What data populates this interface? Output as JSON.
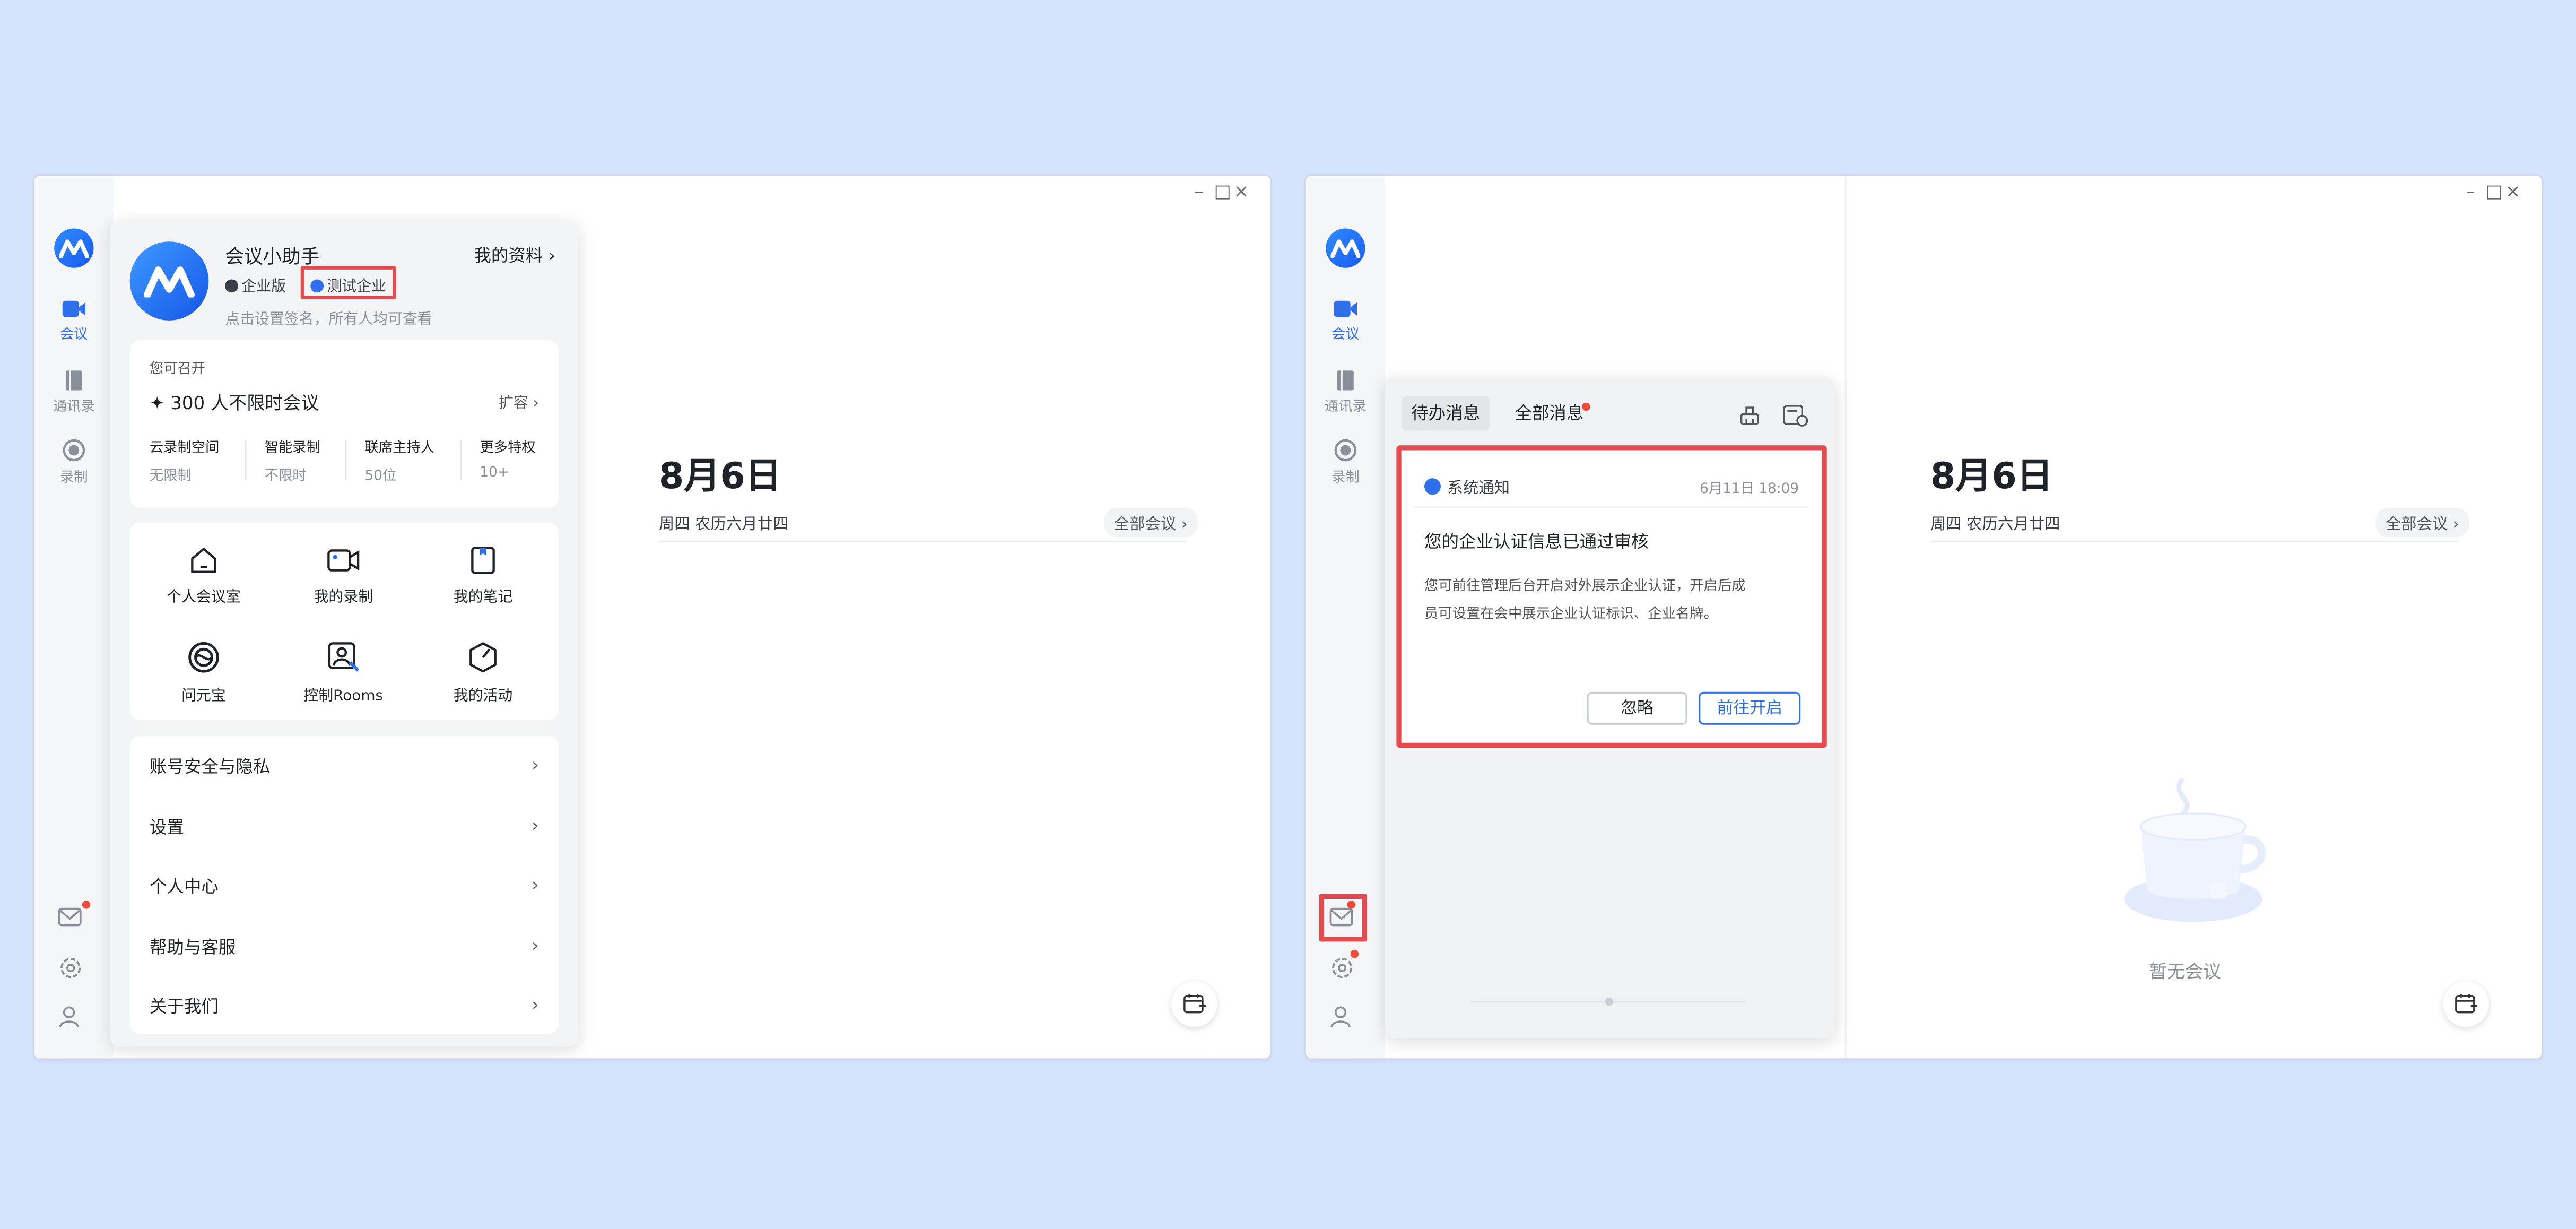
{
  "left_window": {
    "rail": [
      {
        "label": "会议",
        "icon": "video-camera-icon",
        "active": true
      },
      {
        "label": "通讯录",
        "icon": "contacts-book-icon",
        "active": false
      },
      {
        "label": "录制",
        "icon": "record-icon",
        "active": false
      }
    ],
    "profile": {
      "name": "会议小助手",
      "my_profile": "我的资料",
      "edition": "企业版",
      "company": "测试企业",
      "signature_hint": "点击设置签名，所有人均可查看",
      "plan": {
        "title": "您可召开",
        "headline": "300 人不限时会议",
        "expand": "扩容",
        "stats": [
          {
            "label": "云录制空间",
            "value": "无限制"
          },
          {
            "label": "智能录制",
            "value": "不限时"
          },
          {
            "label": "联席主持人",
            "value": "50位"
          },
          {
            "label": "更多特权",
            "value": "10+"
          }
        ]
      },
      "grid": [
        {
          "label": "个人会议室",
          "icon": "home-icon"
        },
        {
          "label": "我的录制",
          "icon": "recording-icon"
        },
        {
          "label": "我的笔记",
          "icon": "notes-icon"
        },
        {
          "label": "问元宝",
          "icon": "yuanbao-icon"
        },
        {
          "label": "控制Rooms",
          "icon": "rooms-control-icon"
        },
        {
          "label": "我的活动",
          "icon": "activity-icon"
        }
      ],
      "menu": [
        "账号安全与隐私",
        "设置",
        "个人中心",
        "帮助与客服",
        "关于我们"
      ]
    },
    "date": {
      "title": "8月6日",
      "sub": "周四 农历六月廿四",
      "all_meetings": "全部会议"
    }
  },
  "right_window": {
    "rail": [
      {
        "label": "会议",
        "icon": "video-camera-icon",
        "active": true
      },
      {
        "label": "通讯录",
        "icon": "contacts-book-icon",
        "active": false
      },
      {
        "label": "录制",
        "icon": "record-icon",
        "active": false
      }
    ],
    "messages": {
      "tabs": [
        "待办消息",
        "全部消息"
      ],
      "notice": {
        "source": "系统通知",
        "time": "6月11日 18:09",
        "title": "您的企业认证信息已通过审核",
        "body": "您可前往管理后台开启对外展示企业认证，开启后成员可设置在会中展示企业认证标识、企业名牌。",
        "ignore": "忽略",
        "go": "前往开启"
      }
    },
    "date": {
      "title": "8月6日",
      "sub": "周四 农历六月廿四",
      "all_meetings": "全部会议"
    },
    "empty": "暂无会议"
  }
}
